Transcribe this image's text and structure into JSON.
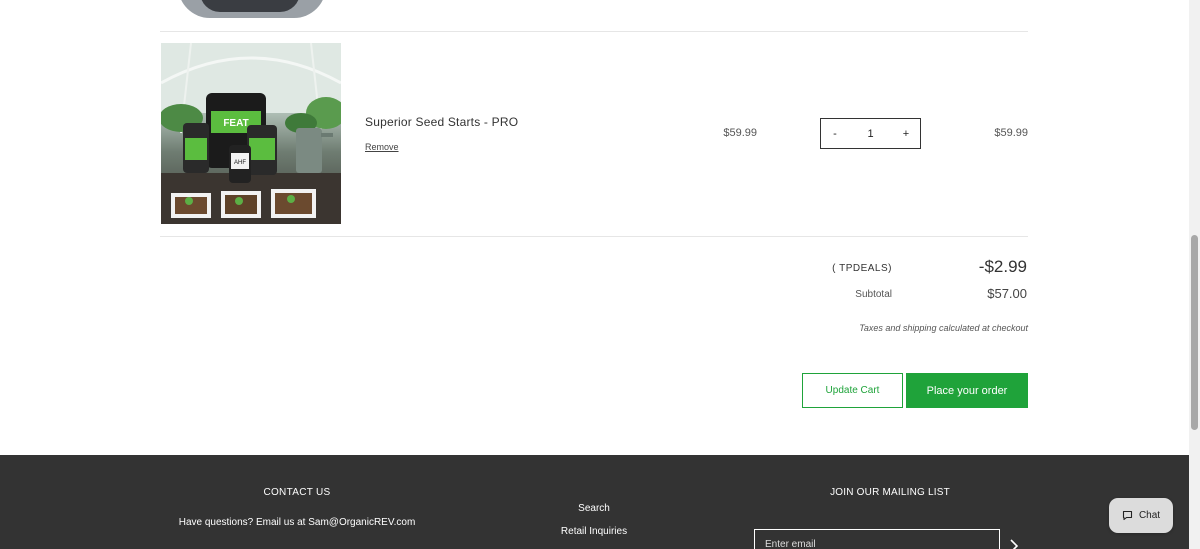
{
  "cart": {
    "item": {
      "name": "Superior Seed Starts - PRO",
      "remove_label": "Remove",
      "price": "$59.99",
      "quantity": "1",
      "qty_minus": "-",
      "qty_plus": "+",
      "line_total": "$59.99"
    },
    "discount": {
      "code": "( TPDEALS)",
      "amount": "-$2.99"
    },
    "subtotal": {
      "label": "Subtotal",
      "amount": "$57.00"
    },
    "tax_note": "Taxes and shipping calculated at checkout",
    "update_cart_label": "Update Cart",
    "place_order_label": "Place your order"
  },
  "footer": {
    "contact_title": "CONTACT US",
    "contact_text": "Have questions? Email us at Sam@OrganicREV.com",
    "links": [
      "Search",
      "Retail Inquiries"
    ],
    "mailing_title": "JOIN OUR MAILING LIST",
    "email_placeholder": "Enter email",
    "submit_icon": "chevron-right-icon"
  },
  "chat": {
    "label": "Chat",
    "icon": "chat-bubble-icon"
  },
  "colors": {
    "accent_green": "#1fa33a",
    "footer_bg": "#333333"
  }
}
